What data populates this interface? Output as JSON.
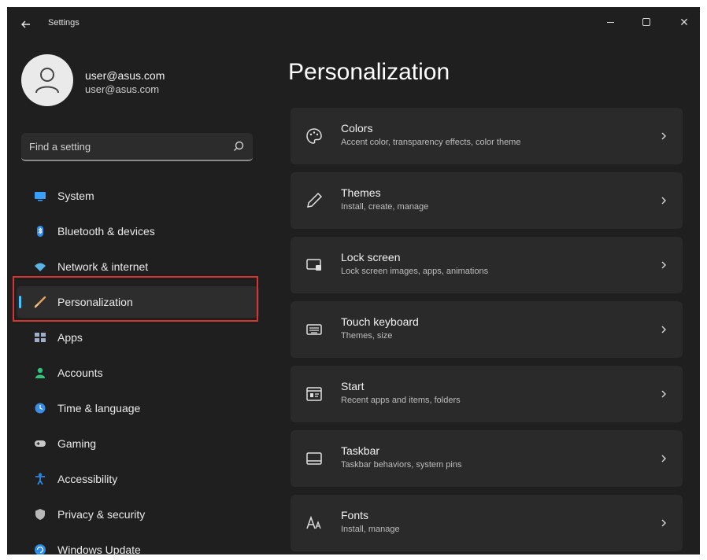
{
  "window": {
    "title": "Settings"
  },
  "profile": {
    "name": "user@asus.com",
    "email": "user@asus.com"
  },
  "search": {
    "placeholder": "Find a setting"
  },
  "sidebar": {
    "items": [
      {
        "label": "System",
        "icon": "display-icon",
        "color": "#3aa0ff"
      },
      {
        "label": "Bluetooth & devices",
        "icon": "bluetooth-icon",
        "color": "#2e8cf0"
      },
      {
        "label": "Network & internet",
        "icon": "wifi-icon",
        "color": "#5ab4e6"
      },
      {
        "label": "Personalization",
        "icon": "brush-icon",
        "color": "#e6a560",
        "active": true
      },
      {
        "label": "Apps",
        "icon": "apps-icon",
        "color": "#9fb0c6"
      },
      {
        "label": "Accounts",
        "icon": "person-icon",
        "color": "#31c27c"
      },
      {
        "label": "Time & language",
        "icon": "globe-clock-icon",
        "color": "#3a8ee6"
      },
      {
        "label": "Gaming",
        "icon": "gamepad-icon",
        "color": "#c9c9c9"
      },
      {
        "label": "Accessibility",
        "icon": "accessibility-icon",
        "color": "#2b88e0"
      },
      {
        "label": "Privacy & security",
        "icon": "shield-icon",
        "color": "#b8b8b8"
      },
      {
        "label": "Windows Update",
        "icon": "update-icon",
        "color": "#2a8ce8"
      }
    ]
  },
  "main": {
    "title": "Personalization",
    "cards": [
      {
        "title": "Colors",
        "subtitle": "Accent color, transparency effects, color theme",
        "icon": "palette-icon"
      },
      {
        "title": "Themes",
        "subtitle": "Install, create, manage",
        "icon": "pen-icon"
      },
      {
        "title": "Lock screen",
        "subtitle": "Lock screen images, apps, animations",
        "icon": "lock-screen-icon"
      },
      {
        "title": "Touch keyboard",
        "subtitle": "Themes, size",
        "icon": "keyboard-icon"
      },
      {
        "title": "Start",
        "subtitle": "Recent apps and items, folders",
        "icon": "start-icon"
      },
      {
        "title": "Taskbar",
        "subtitle": "Taskbar behaviors, system pins",
        "icon": "taskbar-icon"
      },
      {
        "title": "Fonts",
        "subtitle": "Install, manage",
        "icon": "fonts-icon"
      }
    ]
  },
  "colors": {
    "accent": "#4cc2ff",
    "highlight": "#d83434",
    "window_bg": "#1f1f1f",
    "card_bg": "#2a2a2a"
  }
}
